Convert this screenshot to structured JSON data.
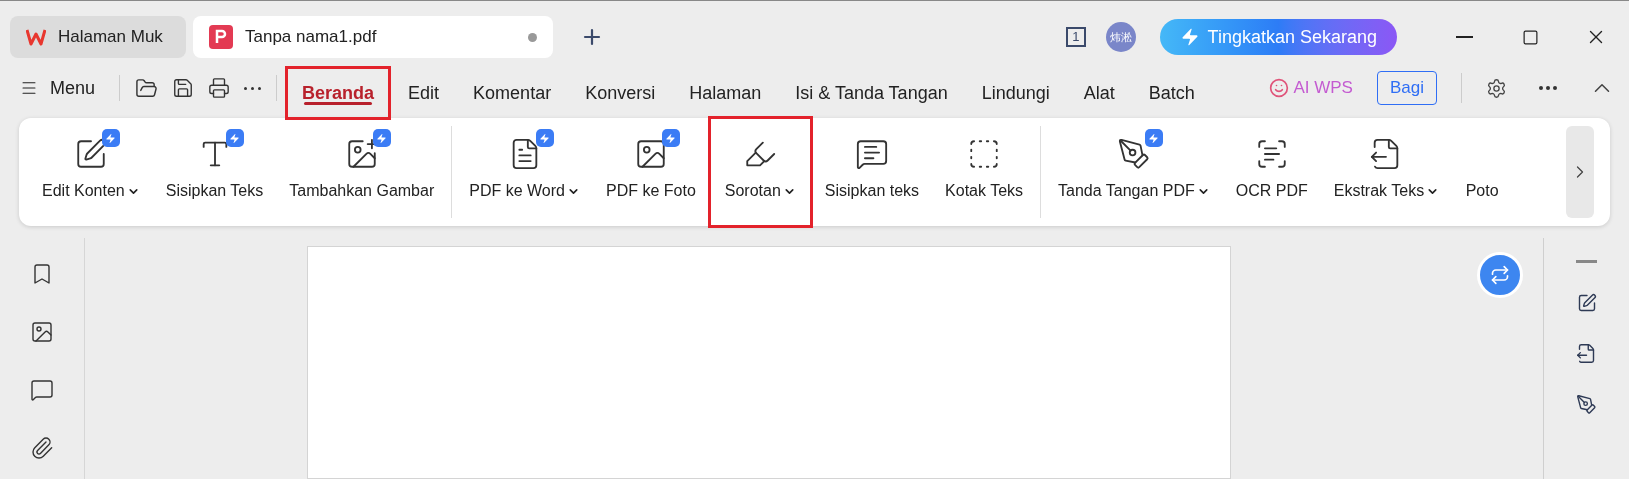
{
  "tabs": [
    {
      "label": "Halaman Muk",
      "kind": "wps",
      "selected": false,
      "unsaved": false
    },
    {
      "label": "Tanpa nama1.pdf",
      "kind": "pdf",
      "selected": true,
      "unsaved": true
    }
  ],
  "title_bar": {
    "page_count": "1",
    "avatar": "炜淞",
    "upgrade": "Tingkatkan Sekarang"
  },
  "menu": {
    "label": "Menu"
  },
  "nav": [
    {
      "label": "Beranda",
      "selected": true,
      "highlighted": true
    },
    {
      "label": "Edit",
      "selected": false,
      "highlighted": false
    },
    {
      "label": "Komentar",
      "selected": false,
      "highlighted": false
    },
    {
      "label": "Konversi",
      "selected": false,
      "highlighted": false
    },
    {
      "label": "Halaman",
      "selected": false,
      "highlighted": false
    },
    {
      "label": "Isi & Tanda Tangan",
      "selected": false,
      "highlighted": false
    },
    {
      "label": "Lindungi",
      "selected": false,
      "highlighted": false
    },
    {
      "label": "Alat",
      "selected": false,
      "highlighted": false
    },
    {
      "label": "Batch",
      "selected": false,
      "highlighted": false
    }
  ],
  "ai": "AI WPS",
  "share": "Bagi",
  "ribbon": [
    {
      "tools": [
        {
          "label": "Edit Konten",
          "kind": "edit",
          "dropdown": true,
          "premium": true,
          "highlighted": false
        },
        {
          "label": "Sisipkan Teks",
          "kind": "type",
          "dropdown": false,
          "premium": true,
          "highlighted": false
        },
        {
          "label": "Tambahkan Gambar",
          "kind": "image",
          "dropdown": false,
          "premium": true,
          "highlighted": false
        }
      ]
    },
    {
      "tools": [
        {
          "label": "PDF ke Word",
          "kind": "word",
          "dropdown": true,
          "premium": true,
          "highlighted": false
        },
        {
          "label": "PDF ke Foto",
          "kind": "photo",
          "dropdown": false,
          "premium": true,
          "highlighted": false
        },
        {
          "label": "Sorotan",
          "kind": "highlight",
          "dropdown": true,
          "premium": false,
          "highlighted": true
        },
        {
          "label": "Sisipkan teks",
          "kind": "comment",
          "dropdown": false,
          "premium": false,
          "highlighted": false
        },
        {
          "label": "Kotak Teks",
          "kind": "textbox",
          "dropdown": false,
          "premium": false,
          "highlighted": false
        }
      ]
    },
    {
      "tools": [
        {
          "label": "Tanda Tangan PDF",
          "kind": "sign",
          "dropdown": true,
          "premium": true,
          "highlighted": false
        },
        {
          "label": "OCR PDF",
          "kind": "ocr",
          "dropdown": false,
          "premium": false,
          "highlighted": false
        },
        {
          "label": "Ekstrak Teks",
          "kind": "extract",
          "dropdown": true,
          "premium": false,
          "highlighted": false
        },
        {
          "label": "Poto",
          "kind": "cut",
          "dropdown": false,
          "premium": false,
          "highlighted": false
        }
      ]
    }
  ]
}
